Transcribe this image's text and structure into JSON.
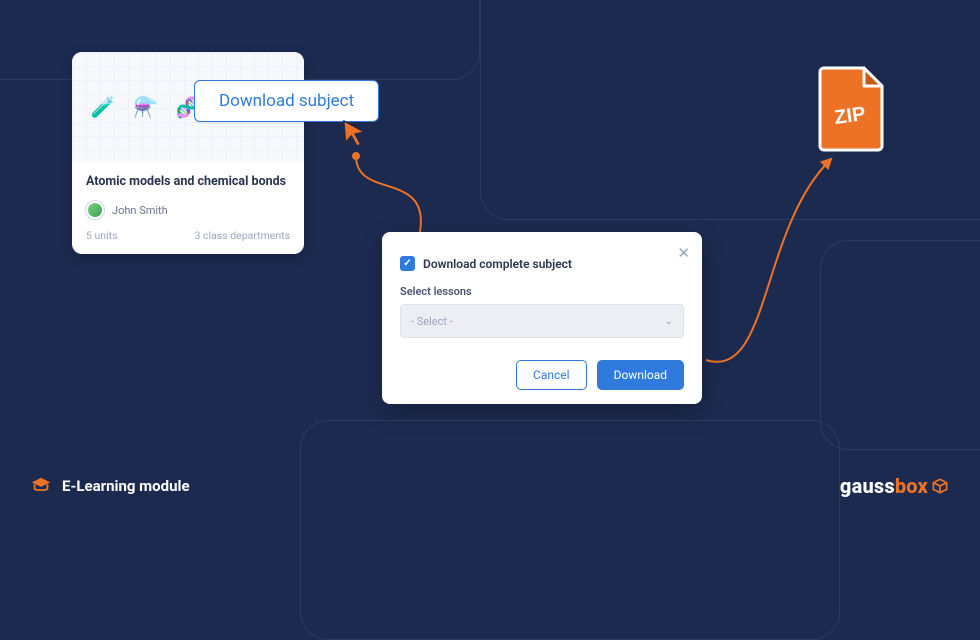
{
  "subjectCard": {
    "title": "Atomic models and chemical bonds",
    "author": "John Smith",
    "units": "5 units",
    "departments": "3 class departments"
  },
  "downloadBubble": {
    "label": "Download subject"
  },
  "dialog": {
    "checkboxLabel": "Download complete subject",
    "selectLessonsLabel": "Select lessons",
    "selectPlaceholder": "- Select -",
    "cancel": "Cancel",
    "download": "Download"
  },
  "zip": {
    "label": "ZIP"
  },
  "footer": {
    "moduleLabel": "E-Learning module",
    "brandMain": "gauss",
    "brandAccent": "box"
  }
}
